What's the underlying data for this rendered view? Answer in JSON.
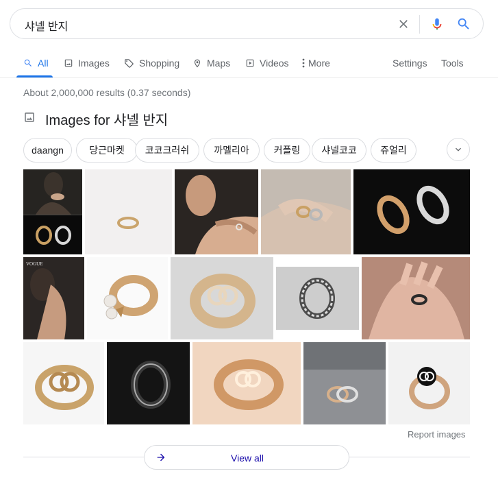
{
  "search": {
    "query": "샤넬 반지"
  },
  "tabs": [
    {
      "label": "All",
      "icon": "search-icon"
    },
    {
      "label": "Images",
      "icon": "image-icon"
    },
    {
      "label": "Shopping",
      "icon": "tag-icon"
    },
    {
      "label": "Maps",
      "icon": "map-pin-icon"
    },
    {
      "label": "Videos",
      "icon": "play-icon"
    },
    {
      "label": "More",
      "icon": "more-vert-icon"
    }
  ],
  "tools": {
    "settings": "Settings",
    "tools": "Tools"
  },
  "result_stats": "About 2,000,000 results (0.37 seconds)",
  "images_section": {
    "heading": "Images for 샤넬 반지",
    "chips": [
      "daangn",
      "당근마켓",
      "코코크러쉬",
      "까멜리아",
      "커플링",
      "샤넬코코",
      "쥬얼리"
    ],
    "report": "Report images",
    "view_all": "View all"
  },
  "colors": {
    "accent": "#1a73e8",
    "link": "#1a0dab",
    "muted": "#70757a",
    "border": "#dadce0"
  }
}
